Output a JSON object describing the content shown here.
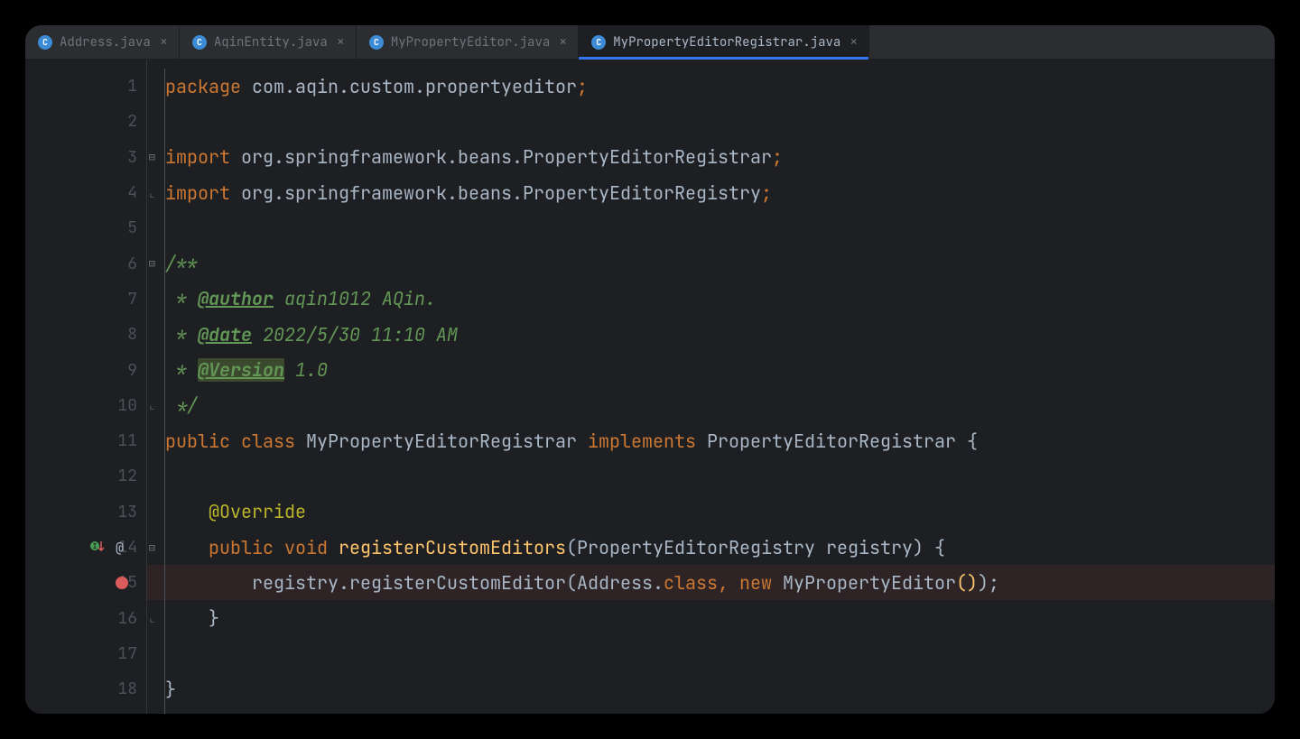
{
  "tabs": [
    {
      "label": "Address.java",
      "active": false
    },
    {
      "label": "AqinEntity.java",
      "active": false
    },
    {
      "label": "MyPropertyEditor.java",
      "active": false
    },
    {
      "label": "MyPropertyEditorRegistrar.java",
      "active": true
    }
  ],
  "gutter": {
    "lines": [
      "1",
      "2",
      "3",
      "4",
      "5",
      "6",
      "7",
      "8",
      "9",
      "10",
      "11",
      "12",
      "13",
      "14",
      "15",
      "16",
      "17",
      "18"
    ],
    "breakpoint_line": "15",
    "override_line": "14"
  },
  "code": {
    "l1": {
      "kw": "package",
      "pkg": " com.aqin.custom.propertyeditor",
      "semi": ";"
    },
    "l3": {
      "kw": "import",
      "pkg": " org.springframework.beans.PropertyEditorRegistrar",
      "semi": ";"
    },
    "l4": {
      "kw": "import",
      "pkg": " org.springframework.beans.PropertyEditorRegistry",
      "semi": ";"
    },
    "l6": "/**",
    "l7": {
      "star": " * ",
      "tag": "@author",
      "rest": " aqin1012 AQin."
    },
    "l8": {
      "star": " * ",
      "tag": "@date",
      "rest": " 2022/5/30 11:10 AM"
    },
    "l9": {
      "star": " * ",
      "tag": "@Version",
      "rest": " 1.0"
    },
    "l10": " */",
    "l11": {
      "pub": "public",
      "cls": " class ",
      "name": "MyPropertyEditorRegistrar ",
      "impl": "implements",
      "iface": " PropertyEditorRegistrar ",
      "brace": "{"
    },
    "l13": "    @Override",
    "l14": {
      "indent": "    ",
      "pub": "public",
      "void": " void ",
      "method": "registerCustomEditors",
      "open": "(",
      "ptype": "PropertyEditorRegistry ",
      "pname": "registry",
      "close": ")",
      "sp": " ",
      "brace": "{"
    },
    "l15": {
      "indent": "        ",
      "obj": "registry.registerCustomEditor(Address.",
      "cls": "class",
      "comma": ", ",
      "new": "new",
      "ctor": " MyPropertyEditor",
      "parens": "()",
      "end": ");"
    },
    "l16": {
      "indent": "    ",
      "brace": "}"
    },
    "l18": {
      "brace": "}"
    }
  }
}
